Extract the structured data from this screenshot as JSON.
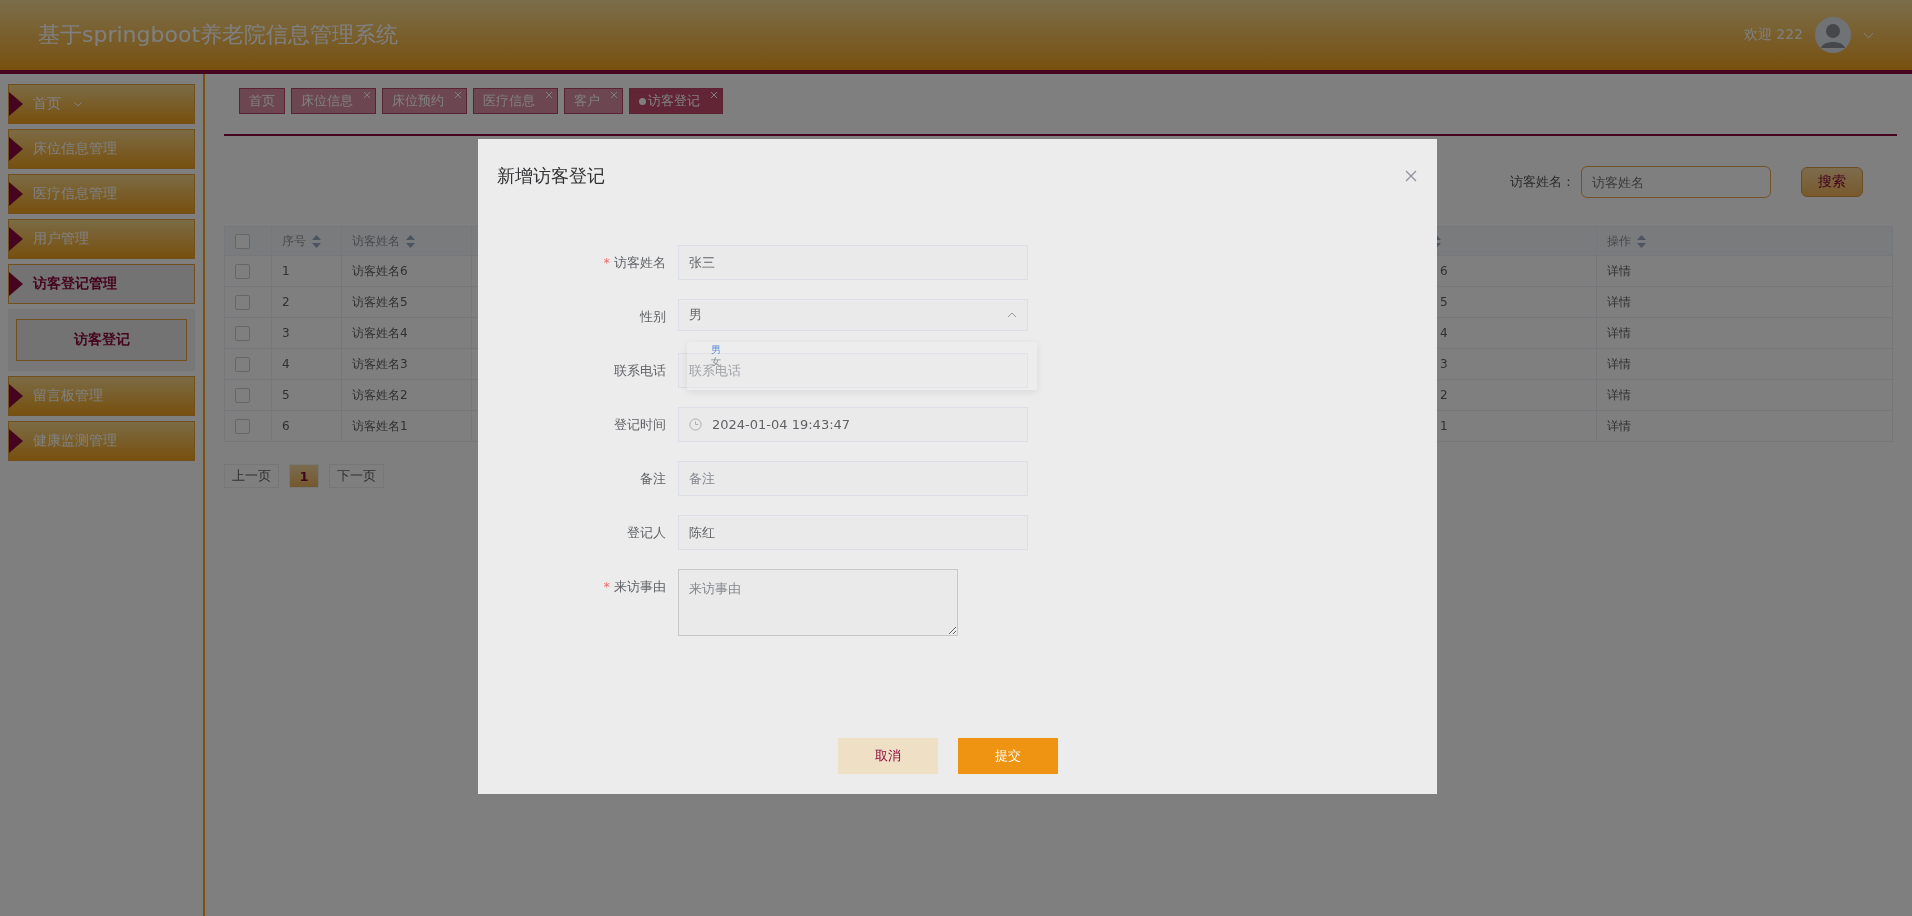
{
  "header": {
    "title": "基于springboot养老院信息管理系统",
    "welcome": "欢迎 222"
  },
  "sidebar": {
    "items": [
      {
        "kind": "link",
        "label": "首页",
        "selected": false,
        "expanded": false
      },
      {
        "kind": "group",
        "label": "床位信息管理",
        "selected": false,
        "expanded": false
      },
      {
        "kind": "group",
        "label": "医疗信息管理",
        "selected": false,
        "expanded": false
      },
      {
        "kind": "group",
        "label": "用户管理",
        "selected": false,
        "expanded": false
      },
      {
        "kind": "group",
        "label": "访客登记管理",
        "selected": true,
        "expanded": true,
        "children": [
          {
            "label": "访客登记",
            "selected": true
          }
        ]
      },
      {
        "kind": "group",
        "label": "留言板管理",
        "selected": false,
        "expanded": false
      },
      {
        "kind": "group",
        "label": "健康监测管理",
        "selected": false,
        "expanded": false
      }
    ]
  },
  "tabs": [
    {
      "label": "首页",
      "closable": false,
      "selected": false
    },
    {
      "label": "床位信息",
      "closable": true,
      "selected": false
    },
    {
      "label": "床位预约",
      "closable": true,
      "selected": false
    },
    {
      "label": "医疗信息",
      "closable": true,
      "selected": false
    },
    {
      "label": "客户",
      "closable": true,
      "selected": false
    },
    {
      "label": "访客登记",
      "closable": true,
      "selected": true
    }
  ],
  "search": {
    "label": "访客姓名：",
    "placeholder": "访客姓名",
    "button": "搜索"
  },
  "table": {
    "all_checked": false,
    "columns": [
      {
        "label": "序号",
        "sortable": true
      },
      {
        "label": "访客姓名",
        "sortable": true
      },
      {
        "sortable": true
      },
      {
        "label": "操作",
        "sortable": true
      }
    ],
    "rows": [
      {
        "checked": false,
        "cells": [
          "1",
          "访客姓名6",
          "6",
          "详情"
        ]
      },
      {
        "checked": false,
        "cells": [
          "2",
          "访客姓名5",
          "5",
          "详情"
        ]
      },
      {
        "checked": false,
        "cells": [
          "3",
          "访客姓名4",
          "4",
          "详情"
        ]
      },
      {
        "checked": false,
        "cells": [
          "4",
          "访客姓名3",
          "3",
          "详情"
        ]
      },
      {
        "checked": false,
        "cells": [
          "5",
          "访客姓名2",
          "2",
          "详情"
        ]
      },
      {
        "checked": false,
        "cells": [
          "6",
          "访客姓名1",
          "1",
          "详情"
        ]
      }
    ]
  },
  "pagination": {
    "prev": "上一页",
    "pages": [
      {
        "label": "1",
        "selected": true
      }
    ],
    "next": "下一页"
  },
  "modal": {
    "title": "新增访客登记",
    "fields": [
      {
        "kind": "text",
        "label": "访客姓名",
        "required_mark": "*",
        "value": "张三"
      },
      {
        "kind": "select",
        "label": "性别",
        "value": "男",
        "expanded": true,
        "options": [
          {
            "label": "男",
            "selected": true
          },
          {
            "label": "女",
            "selected": false
          }
        ]
      },
      {
        "kind": "text",
        "label": "联系电话",
        "placeholder": "联系电话"
      },
      {
        "kind": "datetime",
        "label": "登记时间",
        "value": "2024-01-04 19:43:47"
      },
      {
        "kind": "text",
        "label": "备注",
        "placeholder": "备注"
      },
      {
        "kind": "text",
        "label": "登记人",
        "value": "陈红"
      },
      {
        "kind": "textarea",
        "label": "来访事由",
        "required_mark": "*",
        "placeholder": "来访事由"
      }
    ],
    "buttons": [
      {
        "kind": "cancel",
        "label": "取消"
      },
      {
        "kind": "submit",
        "label": "提交"
      }
    ]
  }
}
